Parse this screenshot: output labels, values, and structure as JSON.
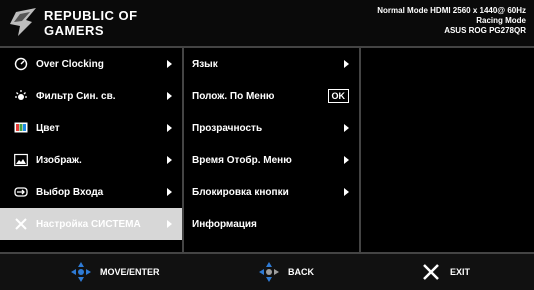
{
  "header": {
    "brand_line1": "REPUBLIC OF",
    "brand_line2": "GAMERS",
    "status_line1": "Normal Mode HDMI 2560 x 1440@ 60Hz",
    "status_line2": "Racing Mode",
    "status_line3": "ASUS ROG PG278QR"
  },
  "main_menu": [
    {
      "label": "Over Clocking",
      "icon": "speedometer-icon"
    },
    {
      "label": "Фильтр Син. св.",
      "icon": "sun-icon"
    },
    {
      "label": "Цвет",
      "icon": "color-icon"
    },
    {
      "label": "Изображ.",
      "icon": "image-icon"
    },
    {
      "label": "Выбор Входа",
      "icon": "input-icon"
    },
    {
      "label": "Настройка СИСТЕМА",
      "icon": "wrench-icon",
      "selected": true
    }
  ],
  "sub_menu": [
    {
      "label": "Язык",
      "indicator": "arrow"
    },
    {
      "label": "Полож. По Меню",
      "indicator": "OK"
    },
    {
      "label": "Прозрачность",
      "indicator": "arrow"
    },
    {
      "label": "Время Отобр. Меню",
      "indicator": "arrow"
    },
    {
      "label": "Блокировка кнопки",
      "indicator": "arrow"
    },
    {
      "label": "Информация",
      "indicator": ""
    }
  ],
  "footer": {
    "move_enter": "MOVE/ENTER",
    "back": "BACK",
    "exit": "EXIT"
  },
  "colors": {
    "accent_blue": "#2e7bd6",
    "selected_bg": "#d7d7d7",
    "divider": "#444444"
  }
}
